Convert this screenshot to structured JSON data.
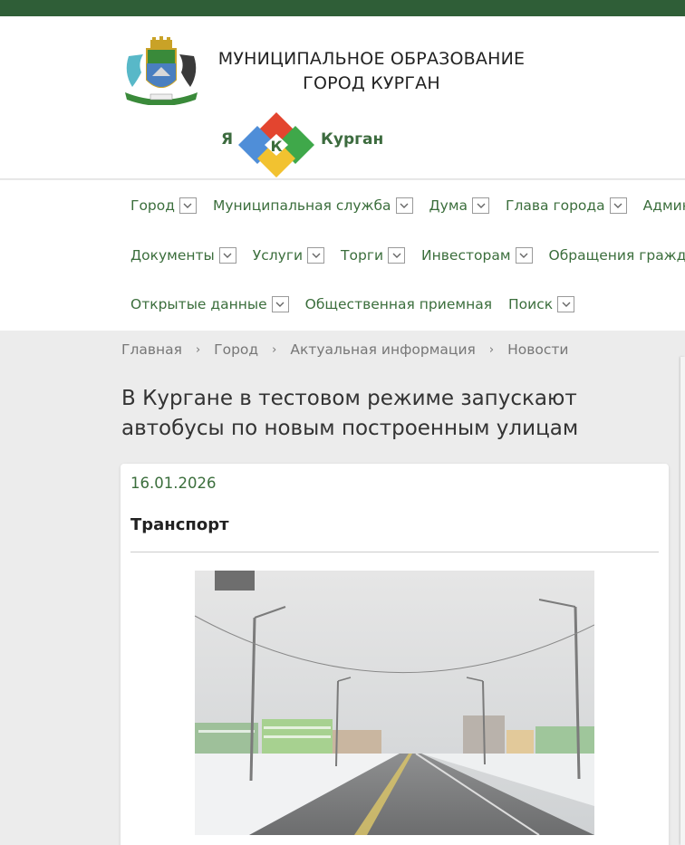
{
  "header": {
    "org_title_line1": "МУНИЦИПАЛЬНОЕ ОБРАЗОВАНИЕ",
    "org_title_line2": "ГОРОД КУРГАН",
    "brand_prefix": "Я",
    "brand_word": "Курган"
  },
  "nav": {
    "rows": [
      [
        {
          "label": "Город",
          "dropdown": true
        },
        {
          "label": "Муниципальная служба",
          "dropdown": true
        },
        {
          "label": "Дума",
          "dropdown": true
        },
        {
          "label": "Глава города",
          "dropdown": true
        },
        {
          "label": "Админист",
          "dropdown": false
        }
      ],
      [
        {
          "label": "Документы",
          "dropdown": true
        },
        {
          "label": "Услуги",
          "dropdown": true
        },
        {
          "label": "Торги",
          "dropdown": true
        },
        {
          "label": "Инвесторам",
          "dropdown": true
        },
        {
          "label": "Обращения граждан",
          "dropdown": false
        }
      ],
      [
        {
          "label": "Открытые данные",
          "dropdown": true
        },
        {
          "label": "Общественная приемная",
          "dropdown": false
        },
        {
          "label": "Поиск",
          "dropdown": true
        }
      ]
    ]
  },
  "breadcrumb": {
    "items": [
      "Главная",
      "Город",
      "Актуальная информация",
      "Новости"
    ],
    "separator": "›"
  },
  "article": {
    "title": "В Кургане в тестовом режиме запускают автобусы по новым построенным улицам",
    "date": "16.01.2026",
    "category": "Транспорт"
  },
  "colors": {
    "topbar": "#2f5e37",
    "link_green": "#3b6e3c",
    "background": "#ececec"
  }
}
